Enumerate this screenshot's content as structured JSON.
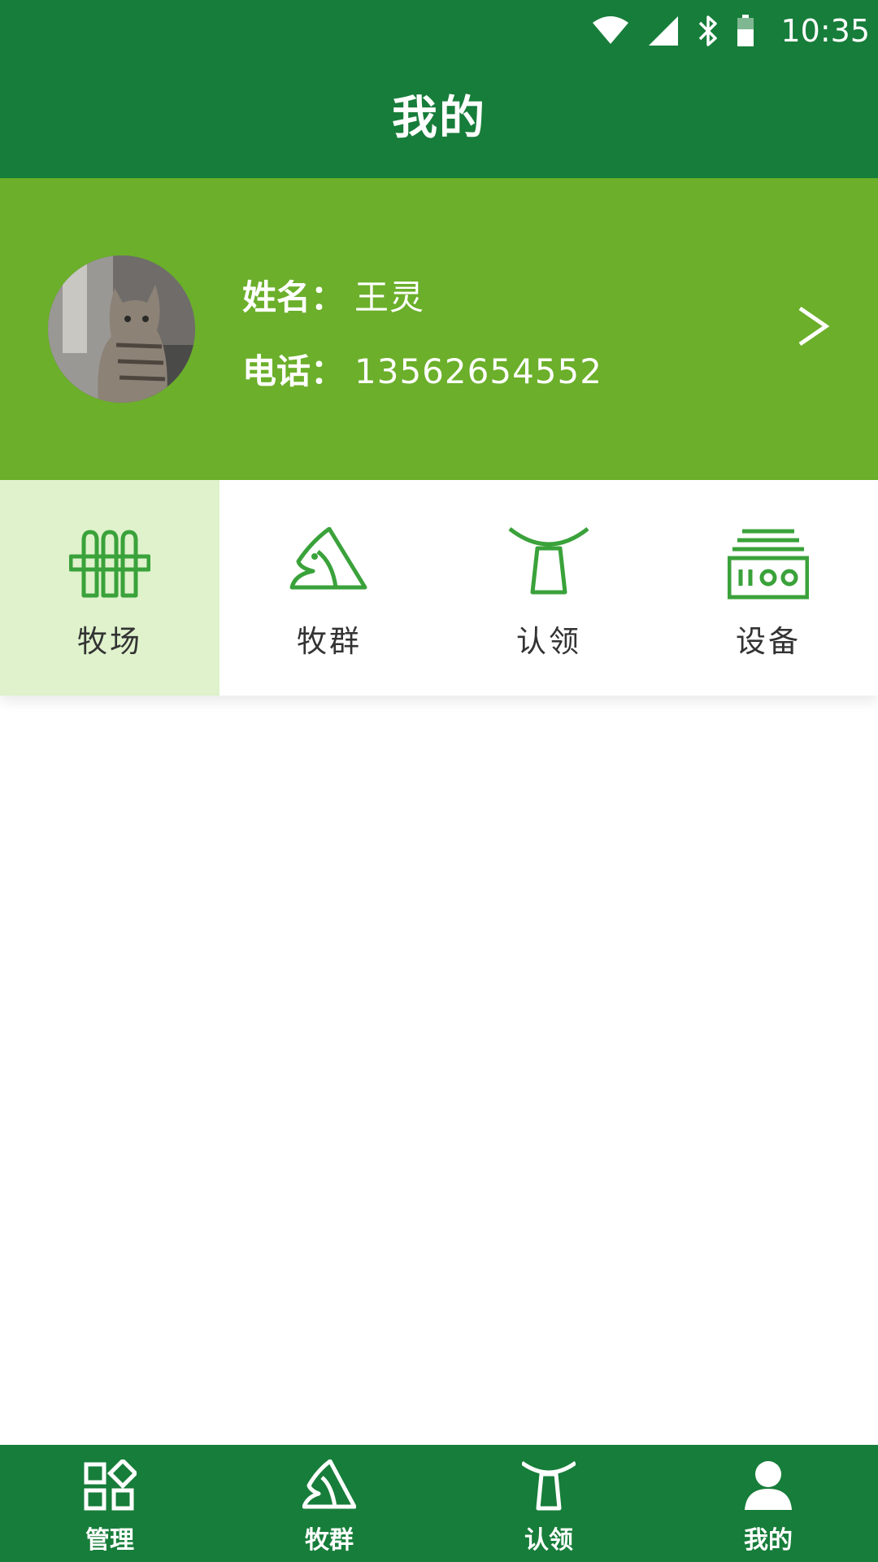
{
  "status_bar": {
    "time": "10:35",
    "icons": [
      "wifi-icon",
      "cell-signal-icon",
      "bluetooth-icon",
      "battery-icon"
    ]
  },
  "header": {
    "title": "我的"
  },
  "profile": {
    "avatar": "cat-photo",
    "name_label": "姓名：",
    "name_value": "王灵",
    "phone_label": "电话：",
    "phone_value": "13562654552",
    "arrow": ">"
  },
  "categories": [
    {
      "label": "牧场",
      "icon": "fence-icon",
      "active": true
    },
    {
      "label": "牧群",
      "icon": "horse-head-icon",
      "active": false
    },
    {
      "label": "认领",
      "icon": "cowbell-icon",
      "active": false
    },
    {
      "label": "设备",
      "icon": "device-icon",
      "active": false
    }
  ],
  "bottom_nav": [
    {
      "label": "管理",
      "icon": "grid-icon"
    },
    {
      "label": "牧群",
      "icon": "horse-head-icon"
    },
    {
      "label": "认领",
      "icon": "cowbell-icon"
    },
    {
      "label": "我的",
      "icon": "person-icon"
    }
  ],
  "colors": {
    "header_green": "#177d3a",
    "profile_green": "#6baf2a",
    "active_tile": "#dff2cc",
    "icon_green": "#3aa23a"
  }
}
